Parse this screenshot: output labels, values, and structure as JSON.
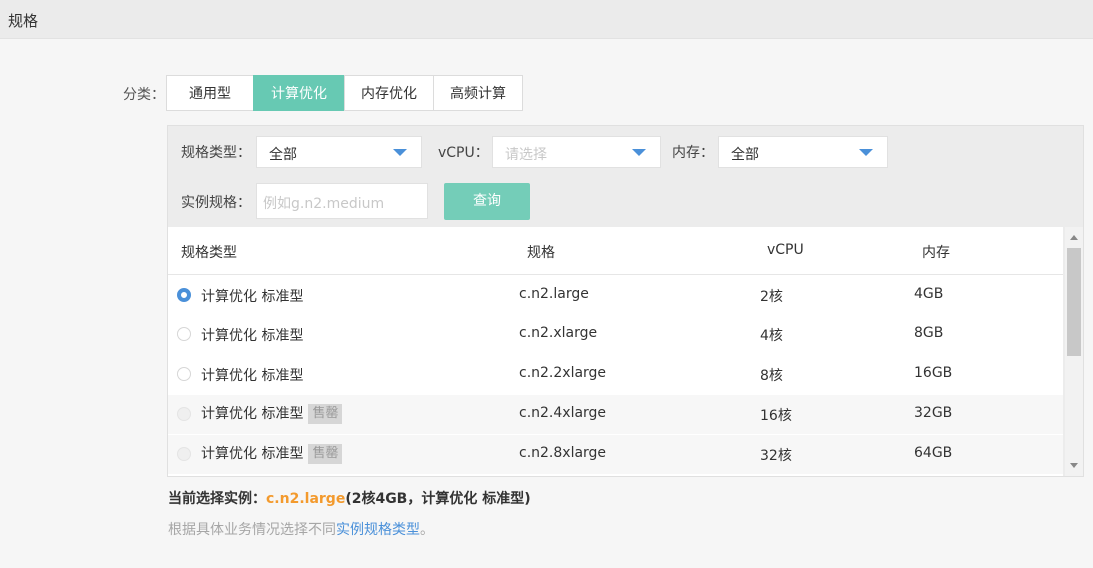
{
  "header": {
    "title": "规格"
  },
  "category": {
    "label": "分类：",
    "tabs": [
      {
        "label": "通用型",
        "active": false
      },
      {
        "label": "计算优化",
        "active": true
      },
      {
        "label": "内存优化",
        "active": false
      },
      {
        "label": "高频计算",
        "active": false
      }
    ]
  },
  "filters": {
    "spec_type_label": "规格类型：",
    "spec_type_value": "全部",
    "vcpu_label": "vCPU：",
    "vcpu_placeholder": "请选择",
    "memory_label": "内存：",
    "memory_value": "全部",
    "instance_label": "实例规格：",
    "instance_placeholder": "例如g.n2.medium",
    "query_button": "查询"
  },
  "table": {
    "columns": [
      "规格类型",
      "规格",
      "vCPU",
      "内存"
    ],
    "rows": [
      {
        "type": "计算优化 标准型",
        "spec": "c.n2.large",
        "vcpu": "2核",
        "memory": "4GB",
        "selected": true,
        "badge": ""
      },
      {
        "type": "计算优化 标准型",
        "spec": "c.n2.xlarge",
        "vcpu": "4核",
        "memory": "8GB",
        "selected": false,
        "badge": ""
      },
      {
        "type": "计算优化 标准型",
        "spec": "c.n2.2xlarge",
        "vcpu": "8核",
        "memory": "16GB",
        "selected": false,
        "badge": ""
      },
      {
        "type": "计算优化 标准型",
        "spec": "c.n2.4xlarge",
        "vcpu": "16核",
        "memory": "32GB",
        "selected": false,
        "badge": "售罄"
      },
      {
        "type": "计算优化 标准型",
        "spec": "c.n2.8xlarge",
        "vcpu": "32核",
        "memory": "64GB",
        "selected": false,
        "badge": "售罄"
      }
    ]
  },
  "current": {
    "prefix": "当前选择实例：",
    "spec": "c.n2.large",
    "detail": "(2核4GB，计算优化 标准型)"
  },
  "hint": {
    "text": "根据具体业务情况选择不同",
    "link": "实例规格类型",
    "suffix": "。"
  },
  "colors": {
    "accent": "#67c9b3",
    "link": "#4a90d9",
    "highlight": "#f39a2d"
  }
}
